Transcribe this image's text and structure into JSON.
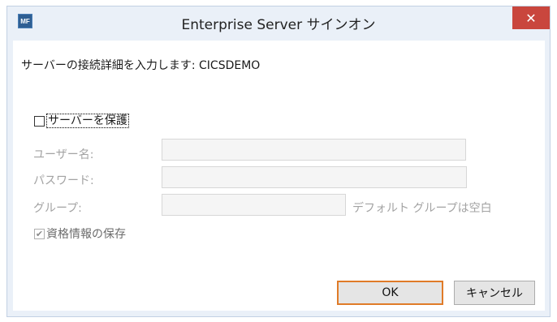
{
  "window": {
    "title": "Enterprise Server サインオン",
    "app_icon_text": "MF",
    "close_glyph": "✕"
  },
  "form": {
    "description": "サーバーの接続詳細を入力します: CICSDEMO",
    "protect_server": {
      "label": "サーバーを保護",
      "checked": false
    },
    "username": {
      "label": "ユーザー名:",
      "value": ""
    },
    "password": {
      "label": "パスワード:",
      "value": ""
    },
    "group": {
      "label": "グループ:",
      "value": "",
      "hint": "デフォルト グループは空白"
    },
    "save_credentials": {
      "label": "資格情報の保存",
      "checked": true,
      "check_glyph": "✔"
    }
  },
  "buttons": {
    "ok": "OK",
    "cancel": "キャンセル"
  },
  "colors": {
    "ok_border": "#e07b28",
    "close_bg": "#c9463d",
    "frame": "#eaf0f8"
  }
}
